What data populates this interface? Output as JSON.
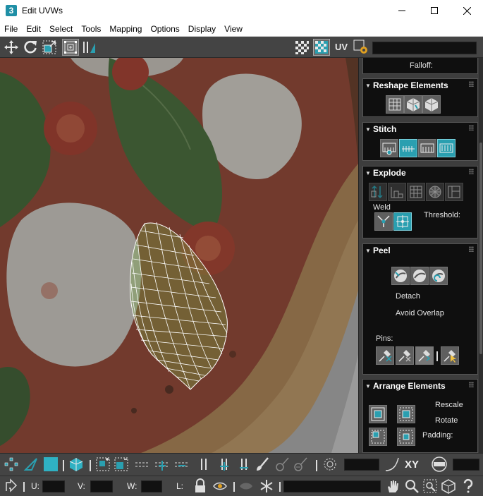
{
  "window": {
    "app_icon": "3",
    "title": "Edit UVWs",
    "minimize_icon": "minimize-icon",
    "maximize_icon": "maximize-icon",
    "close_icon": "close-icon"
  },
  "menu": [
    "File",
    "Edit",
    "Select",
    "Tools",
    "Mapping",
    "Options",
    "Display",
    "View"
  ],
  "toolbar_top": {
    "uv_label": "UV"
  },
  "panel": {
    "falloff_label": "Falloff:",
    "reshape": {
      "title": "Reshape Elements"
    },
    "stitch": {
      "title": "Stitch"
    },
    "explode": {
      "title": "Explode",
      "weld_label": "Weld",
      "threshold_label": "Threshold:"
    },
    "peel": {
      "title": "Peel",
      "detach_label": "Detach",
      "avoid_overlap_label": "Avoid Overlap",
      "pins_label": "Pins:"
    },
    "arrange": {
      "title": "Arrange Elements",
      "rescale_label": "Rescale",
      "rotate_label": "Rotate",
      "padding_label": "Padding:"
    }
  },
  "toolbar_bottom": {
    "xy_label": "XY",
    "u_label": "U:",
    "v_label": "V:",
    "w_label": "W:",
    "l_label": "L:"
  },
  "colors": {
    "accent": "#2a9fb0",
    "chrome": "#444444",
    "panel": "#0f0f0f"
  }
}
